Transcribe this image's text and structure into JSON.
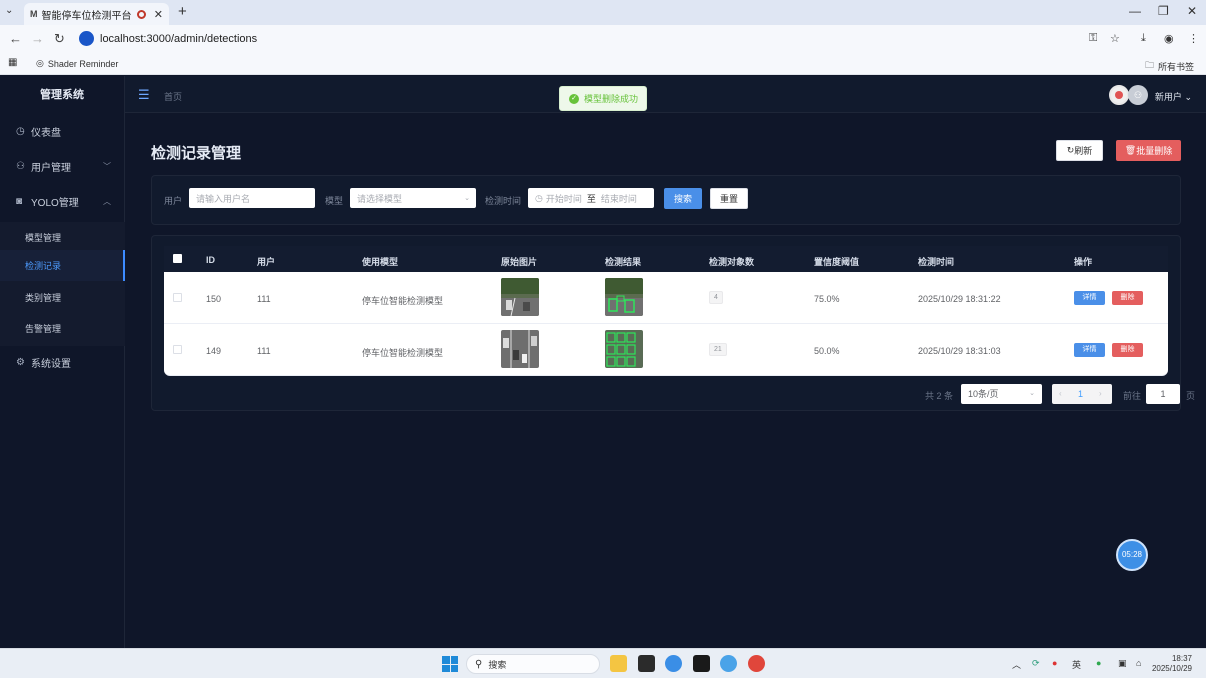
{
  "browser": {
    "tab_title": "智能停车位检测平台",
    "tab_fav": "M",
    "url": "localhost:3000/admin/detections",
    "bookmark_item": "Shader Reminder",
    "bookmark_all": "所有书签"
  },
  "sidebar": {
    "brand": "管理系统",
    "items": [
      {
        "label": "仪表盘"
      },
      {
        "label": "用户管理"
      },
      {
        "label": "YOLO管理"
      },
      {
        "label": "系统设置"
      }
    ],
    "sub_items": [
      {
        "label": "模型管理"
      },
      {
        "label": "检测记录"
      },
      {
        "label": "类别管理"
      },
      {
        "label": "告警管理"
      }
    ]
  },
  "header": {
    "breadcrumb": "首页",
    "username": "新用户"
  },
  "toast": "模型删除成功",
  "page": {
    "title": "检测记录管理",
    "refresh_label": "刷新",
    "batch_delete_label": "批量删除"
  },
  "filters": {
    "user_label": "用户",
    "user_placeholder": "请输入用户名",
    "model_label": "模型",
    "model_placeholder": "请选择模型",
    "time_label": "检测时间",
    "start_placeholder": "开始时间",
    "range_sep": "至",
    "end_placeholder": "结束时间",
    "search_label": "搜索",
    "reset_label": "重置"
  },
  "table": {
    "headers": [
      "ID",
      "用户",
      "使用模型",
      "原始图片",
      "检测结果",
      "检测对象数",
      "置信度阈值",
      "检测时间",
      "操作"
    ],
    "rows": [
      {
        "id": "150",
        "user": "111",
        "model": "停车位智能检测模型",
        "count": "4",
        "conf": "75.0%",
        "time": "2025/10/29 18:31:22"
      },
      {
        "id": "149",
        "user": "111",
        "model": "停车位智能检测模型",
        "count": "21",
        "conf": "50.0%",
        "time": "2025/10/29 18:31:03"
      }
    ],
    "detail_label": "详情",
    "delete_label": "删除"
  },
  "pagination": {
    "total": "共 2 条",
    "page_size": "10条/页",
    "current": "1",
    "goto_label": "前往",
    "goto_value": "1",
    "page_suffix": "页"
  },
  "timer": "05:28",
  "taskbar": {
    "search": "搜索",
    "ime": "英",
    "time": "18:37",
    "date": "2025/10/29"
  },
  "colors": {
    "primary": "#4a8fe8",
    "danger": "#e45e5e",
    "success": "#67c23a",
    "sidebar_bg": "#0f1629"
  }
}
